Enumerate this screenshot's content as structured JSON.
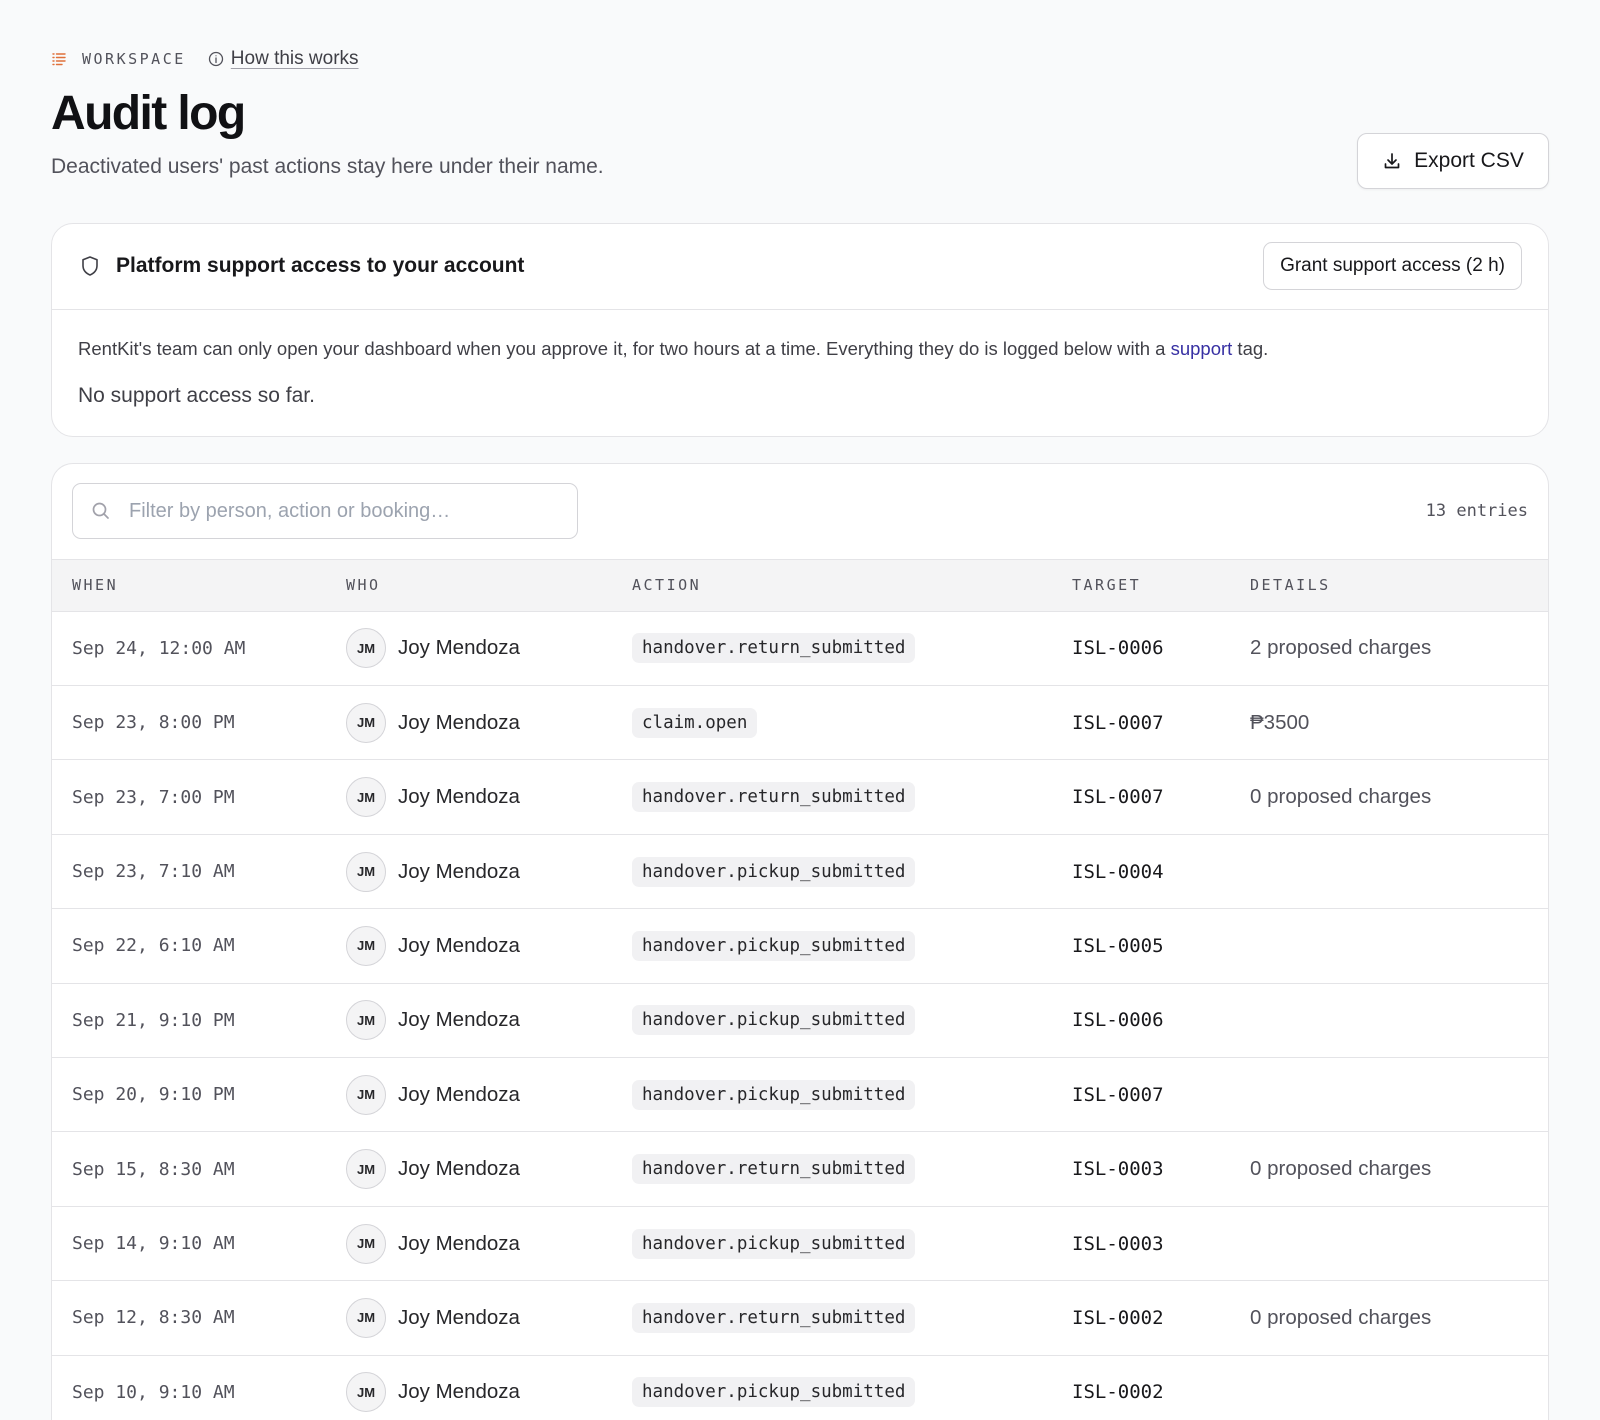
{
  "breadcrumb": {
    "section": "WORKSPACE",
    "help_link": "How this works"
  },
  "header": {
    "title": "Audit log",
    "subtitle": "Deactivated users' past actions stay here under their name.",
    "export_label": "Export CSV"
  },
  "support": {
    "title": "Platform support access to your account",
    "grant_label": "Grant support access (2 h)",
    "desc_before": "RentKit's team can only open your dashboard when you approve it, for two hours at a time. Everything they do is logged below with a ",
    "desc_link": "support",
    "desc_after": " tag.",
    "empty": "No support access so far."
  },
  "filter": {
    "placeholder": "Filter by person, action or booking…",
    "count": "13 entries"
  },
  "table": {
    "columns": [
      "WHEN",
      "WHO",
      "ACTION",
      "TARGET",
      "DETAILS"
    ],
    "rows": [
      {
        "when": "Sep 24, 12:00 AM",
        "initials": "JM",
        "who": "Joy Mendoza",
        "action": "handover.return_submitted",
        "target": "ISL-0006",
        "details": "2 proposed charges"
      },
      {
        "when": "Sep 23, 8:00 PM",
        "initials": "JM",
        "who": "Joy Mendoza",
        "action": "claim.open",
        "target": "ISL-0007",
        "details": "₱3500"
      },
      {
        "when": "Sep 23, 7:00 PM",
        "initials": "JM",
        "who": "Joy Mendoza",
        "action": "handover.return_submitted",
        "target": "ISL-0007",
        "details": "0 proposed charges"
      },
      {
        "when": "Sep 23, 7:10 AM",
        "initials": "JM",
        "who": "Joy Mendoza",
        "action": "handover.pickup_submitted",
        "target": "ISL-0004",
        "details": ""
      },
      {
        "when": "Sep 22, 6:10 AM",
        "initials": "JM",
        "who": "Joy Mendoza",
        "action": "handover.pickup_submitted",
        "target": "ISL-0005",
        "details": ""
      },
      {
        "when": "Sep 21, 9:10 PM",
        "initials": "JM",
        "who": "Joy Mendoza",
        "action": "handover.pickup_submitted",
        "target": "ISL-0006",
        "details": ""
      },
      {
        "when": "Sep 20, 9:10 PM",
        "initials": "JM",
        "who": "Joy Mendoza",
        "action": "handover.pickup_submitted",
        "target": "ISL-0007",
        "details": ""
      },
      {
        "when": "Sep 15, 8:30 AM",
        "initials": "JM",
        "who": "Joy Mendoza",
        "action": "handover.return_submitted",
        "target": "ISL-0003",
        "details": "0 proposed charges"
      },
      {
        "when": "Sep 14, 9:10 AM",
        "initials": "JM",
        "who": "Joy Mendoza",
        "action": "handover.pickup_submitted",
        "target": "ISL-0003",
        "details": ""
      },
      {
        "when": "Sep 12, 8:30 AM",
        "initials": "JM",
        "who": "Joy Mendoza",
        "action": "handover.return_submitted",
        "target": "ISL-0002",
        "details": "0 proposed charges"
      },
      {
        "when": "Sep 10, 9:10 AM",
        "initials": "JM",
        "who": "Joy Mendoza",
        "action": "handover.pickup_submitted",
        "target": "ISL-0002",
        "details": ""
      }
    ]
  },
  "colors": {
    "accent_icon": "#e0703a",
    "link": "#3730a3",
    "border": "#e4e4e7"
  },
  "icons": {
    "breadcrumb": "list-icon",
    "help": "info-icon",
    "export": "download-icon",
    "support": "shield-icon",
    "search": "search-icon"
  }
}
